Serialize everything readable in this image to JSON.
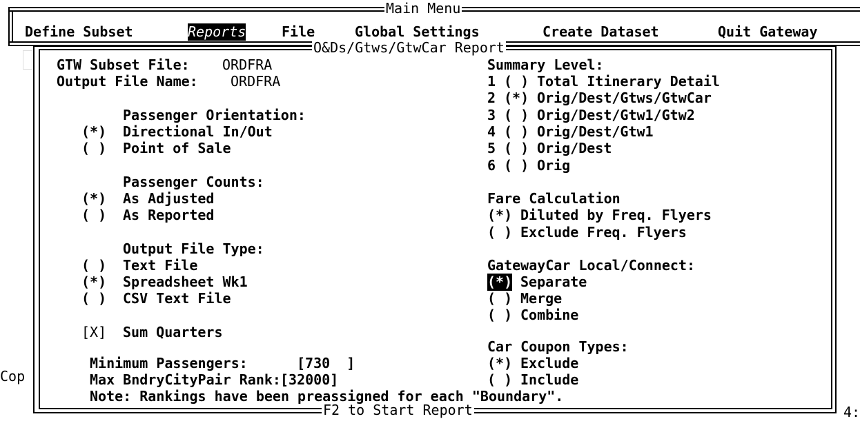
{
  "main_menu": {
    "title": "Main Menu",
    "items": [
      {
        "label": "Define Subset"
      },
      {
        "label": "Reports"
      },
      {
        "label": "File"
      },
      {
        "label": "Global Settings"
      },
      {
        "label": "Create Dataset"
      },
      {
        "label": "Quit Gateway"
      }
    ]
  },
  "background": {
    "copyright_fragment": "Cop",
    "right_fragment": "4:"
  },
  "dialog": {
    "title": "O&Ds/Gtws/GtwCar Report",
    "footer": "F2 to Start Report",
    "subset_file_label": "GTW Subset File:",
    "subset_file_value": "ORDFRA",
    "output_file_label": "Output File Name:",
    "output_file_value": "ORDFRA",
    "passenger_orientation": {
      "heading": "Passenger Orientation:",
      "options": [
        {
          "mark": "(*)",
          "label": "Directional In/Out"
        },
        {
          "mark": "( )",
          "label": "Point of Sale"
        }
      ]
    },
    "passenger_counts": {
      "heading": "Passenger Counts:",
      "options": [
        {
          "mark": "(*)",
          "label": "As Adjusted"
        },
        {
          "mark": "( )",
          "label": "As Reported"
        }
      ]
    },
    "output_file_type": {
      "heading": "Output File Type:",
      "options": [
        {
          "mark": "( )",
          "label": "Text File"
        },
        {
          "mark": "(*)",
          "label": "Spreadsheet Wk1"
        },
        {
          "mark": "( )",
          "label": "CSV Text File"
        }
      ]
    },
    "sum_quarters": {
      "mark": "[X]",
      "label": "Sum Quarters"
    },
    "minimum_passengers": {
      "label": "Minimum Passengers:",
      "value": "[730  ]"
    },
    "max_rank": {
      "label": "Max BndryCityPair Rank:",
      "value": "[32000]"
    },
    "note": "Note: Rankings have been preassigned for each \"Boundary\".",
    "summary_level": {
      "heading": "Summary Level:",
      "options": [
        {
          "num": "1",
          "mark": "( )",
          "label": "Total Itinerary Detail"
        },
        {
          "num": "2",
          "mark": "(*)",
          "label": "Orig/Dest/Gtws/GtwCar"
        },
        {
          "num": "3",
          "mark": "( )",
          "label": "Orig/Dest/Gtw1/Gtw2"
        },
        {
          "num": "4",
          "mark": "( )",
          "label": "Orig/Dest/Gtw1"
        },
        {
          "num": "5",
          "mark": "( )",
          "label": "Orig/Dest"
        },
        {
          "num": "6",
          "mark": "( )",
          "label": "Orig"
        }
      ]
    },
    "fare_calculation": {
      "heading": "Fare Calculation",
      "options": [
        {
          "mark": "(*)",
          "label": "Diluted by Freq. Flyers"
        },
        {
          "mark": "( )",
          "label": "Exclude Freq. Flyers"
        }
      ]
    },
    "gatewaycar": {
      "heading": "GatewayCar Local/Connect:",
      "options": [
        {
          "mark": "(*)",
          "label": "Separate"
        },
        {
          "mark": "( )",
          "label": "Merge"
        },
        {
          "mark": "( )",
          "label": "Combine"
        }
      ]
    },
    "car_coupon": {
      "heading": "Car Coupon Types:",
      "options": [
        {
          "mark": "(*)",
          "label": "Exclude"
        },
        {
          "mark": "( )",
          "label": "Include"
        }
      ]
    }
  }
}
